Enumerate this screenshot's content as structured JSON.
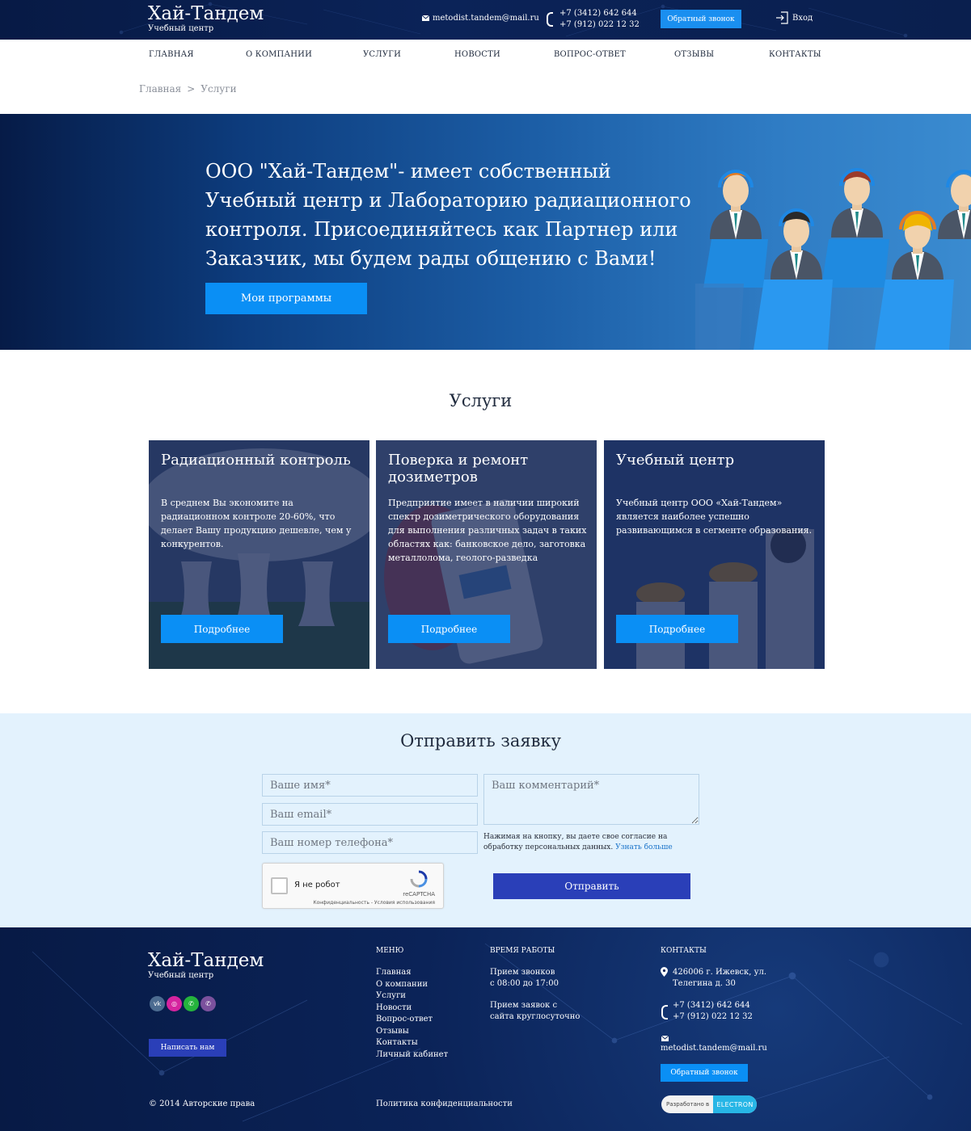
{
  "header": {
    "brand_name": "Хай-Тандем",
    "brand_sub": "Учебный центр",
    "email": "metodist.tandem@mail.ru",
    "phone_1": "+7 (3412) 642 644",
    "phone_2": "+7 (912) 022 12 32",
    "callback_label": "Обратный звонок",
    "login_label": "Вход"
  },
  "nav": {
    "items": [
      "Главная",
      "О компании",
      "Услуги",
      "Новости",
      "Вопрос-ответ",
      "Отзывы",
      "Контакты"
    ]
  },
  "breadcrumb": {
    "home": "Главная",
    "separator": ">",
    "current": "Услуги"
  },
  "hero": {
    "text": "ООО \"Хай-Тандем\"- имеет собственный Учебный центр и Лабораторию радиационного контроля. Присоединяйтесь как Партнер или Заказчик, мы будем рады общению с Вами!",
    "button_label": "Мои программы"
  },
  "services": {
    "title": "Услуги",
    "cards": [
      {
        "title": "Радиационный контроль",
        "text": "В среднем Вы экономите на радиационном контроле 20-60%, что делает Вашу продукцию дешевле, чем у конкурентов.",
        "button_label": "Подробнее"
      },
      {
        "title": "Поверка и ремонт дозиметров",
        "text": "Предприятие имеет в наличии широкий спектр дозиметрического оборудования для выполнения различных задач в таких областях как: банковское дело, заготовка металлолома, геолого-разведка",
        "button_label": "Подробнее"
      },
      {
        "title": "Учебный центр",
        "text": "Учебный центр ООО «Хай-Тандем» является наиболее успешно развивающимся в сегменте образования.",
        "button_label": "Подробнее"
      }
    ]
  },
  "form": {
    "title": "Отправить заявку",
    "name_placeholder": "Ваше имя*",
    "email_placeholder": "Ваш email*",
    "phone_placeholder": "Ваш номер телефона*",
    "comment_placeholder": "Ваш комментарий*",
    "consent_text": "Нажимая на кнопку, вы даете свое согласие на обработку персональных данных.",
    "consent_link": "Узнать больше",
    "captcha_label": "Я не робот",
    "captcha_brand": "reCAPTCHA",
    "captcha_terms": "Конфиденциальность - Условия использования",
    "submit_label": "Отправить"
  },
  "footer": {
    "brand_name": "Хай-Тандем",
    "brand_sub": "Учебный центр",
    "social": [
      "vk",
      "instagram",
      "whatsapp",
      "viber"
    ],
    "write_label": "Написать нам",
    "menu_title": "Меню",
    "menu_items": [
      "Главная",
      "О компании",
      "Услуги",
      "Новости",
      "Вопрос-ответ",
      "Отзывы",
      "Контакты",
      "Личный кабинет"
    ],
    "hours_title": "Время работы",
    "hours_1_line1": "Прием звонков",
    "hours_1_line2": "с 08:00 до 17:00",
    "hours_2_line1": "Прием заявок с",
    "hours_2_line2": "сайта круглосуточно",
    "contacts_title": "Контакты",
    "address_line1": "426006 г. Ижевск, ул.",
    "address_line2": "Телегина д. 30",
    "phone_1": "+7 (3412) 642 644",
    "phone_2": "+7 (912) 022 12 32",
    "email": "metodist.tandem@mail.ru",
    "callback_label": "Обратный звонок",
    "copyright": "© 2014 Авторские права",
    "privacy": "Политика конфиденциальности",
    "dev_left": "Разработано в",
    "dev_right": "ELECTRON"
  },
  "colors": {
    "accent": "#0a8ff5",
    "submit": "#2a3fb8",
    "dark_navy": "#0b2358",
    "form_bg": "#e3f2fd"
  }
}
